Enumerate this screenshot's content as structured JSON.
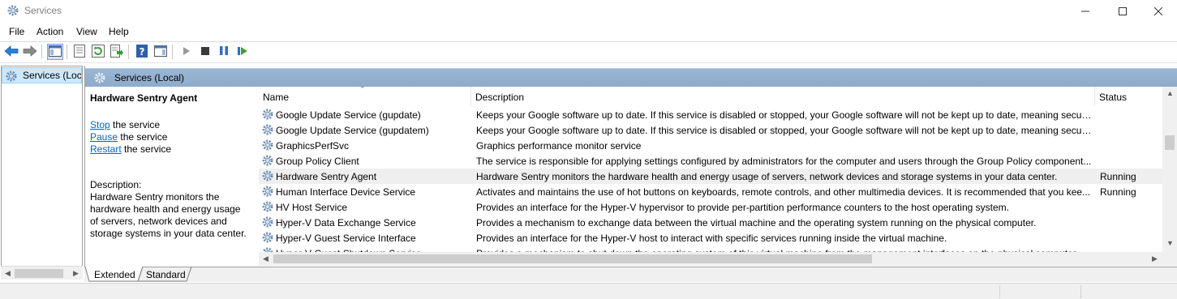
{
  "window": {
    "title": "Services",
    "icons": {
      "app": "gear-icon",
      "minimize": "minimize-icon",
      "maximize": "maximize-icon",
      "close": "close-icon"
    }
  },
  "menu": {
    "items": [
      "File",
      "Action",
      "View",
      "Help"
    ]
  },
  "toolbar": {
    "buttons": [
      {
        "icon": "back-arrow-icon"
      },
      {
        "icon": "forward-arrow-icon"
      },
      {
        "icon": "show-hide-console-tree-icon"
      },
      {
        "icon": "properties-icon"
      },
      {
        "icon": "refresh-icon"
      },
      {
        "icon": "export-list-icon"
      },
      {
        "icon": "help-icon"
      },
      {
        "icon": "show-hide-action-pane-icon"
      },
      {
        "icon": "start-service-icon"
      },
      {
        "icon": "stop-service-icon"
      },
      {
        "icon": "pause-service-icon"
      },
      {
        "icon": "restart-service-icon"
      }
    ]
  },
  "tree": {
    "selected_item": "Services (Local)",
    "selected_item_visible": "Services (Loca"
  },
  "pane_header": {
    "title": "Services (Local)"
  },
  "details": {
    "service_name": "Hardware Sentry Agent",
    "actions": [
      {
        "link": "Stop",
        "suffix": " the service"
      },
      {
        "link": "Pause",
        "suffix": " the service"
      },
      {
        "link": "Restart",
        "suffix": " the service"
      }
    ],
    "description_label": "Description:",
    "description_text": "Hardware Sentry monitors the hardware health and energy usage of servers, network devices and storage systems in your data center."
  },
  "list": {
    "columns": [
      "Name",
      "Description",
      "Status"
    ],
    "rows": [
      {
        "name": "Google Update Service (gupdate)",
        "description": "Keeps your Google software up to date. If this service is disabled or stopped, your Google software will not be kept up to date, meaning securit...",
        "status": ""
      },
      {
        "name": "Google Update Service (gupdatem)",
        "description": "Keeps your Google software up to date. If this service is disabled or stopped, your Google software will not be kept up to date, meaning securit...",
        "status": ""
      },
      {
        "name": "GraphicsPerfSvc",
        "description": "Graphics performance monitor service",
        "status": ""
      },
      {
        "name": "Group Policy Client",
        "description": "The service is responsible for applying settings configured by administrators for the computer and users through the Group Policy component...",
        "status": ""
      },
      {
        "name": "Hardware Sentry Agent",
        "description": "Hardware Sentry monitors the hardware health and energy usage of servers, network devices and storage systems in your data center.",
        "status": "Running",
        "selected": true
      },
      {
        "name": "Human Interface Device Service",
        "description": "Activates and maintains the use of hot buttons on keyboards, remote controls, and other multimedia devices. It is recommended that you kee...",
        "status": "Running"
      },
      {
        "name": "HV Host Service",
        "description": "Provides an interface for the Hyper-V hypervisor to provide per-partition performance counters to the host operating system.",
        "status": ""
      },
      {
        "name": "Hyper-V Data Exchange Service",
        "description": "Provides a mechanism to exchange data between the virtual machine and the operating system running on the physical computer.",
        "status": ""
      },
      {
        "name": "Hyper-V Guest Service Interface",
        "description": "Provides an interface for the Hyper-V host to interact with specific services running inside the virtual machine.",
        "status": ""
      },
      {
        "name": "Hyper-V Guest Shutdown Service",
        "description": "Provides a mechanism to shut down the operating system of this virtual machine from the management interfaces on the physical computer.",
        "status": ""
      }
    ]
  },
  "tabs": [
    "Extended",
    "Standard"
  ],
  "colors": {
    "band": "#9ab6d4",
    "selection": "#cce8ff",
    "link": "#0066cc",
    "toolbar_play": "#4a9a3a",
    "toolbar_pause": "#2f6fbf"
  }
}
